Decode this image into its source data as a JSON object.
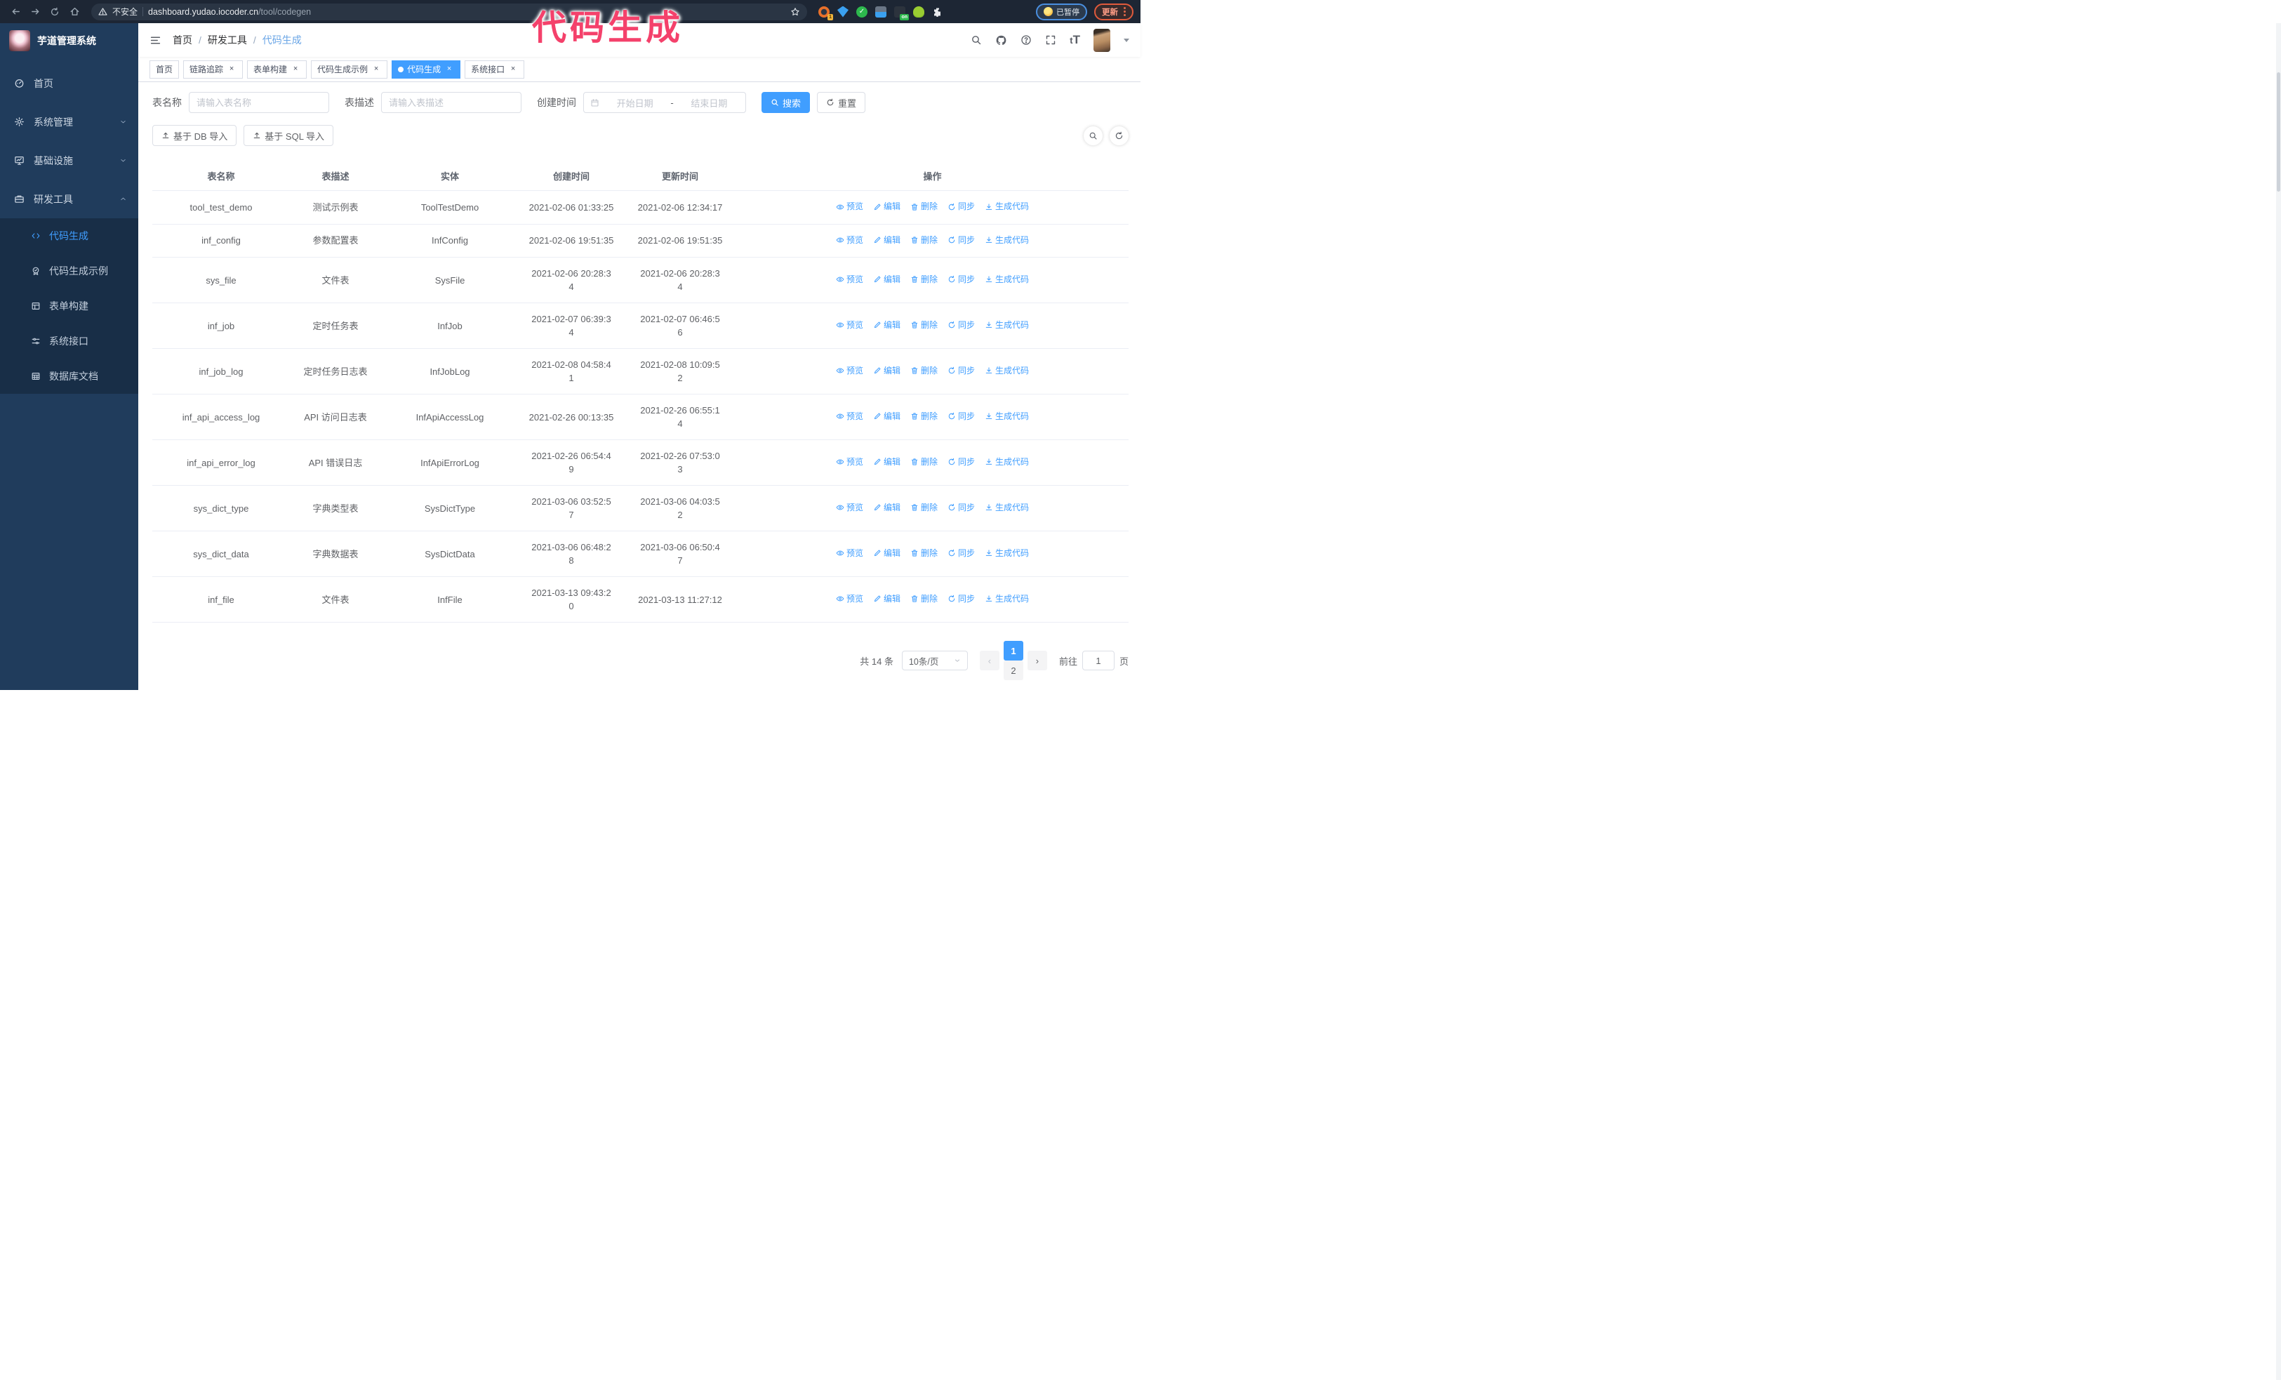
{
  "browser": {
    "security_label": "不安全",
    "url_host": "dashboard.yudao.iocoder.cn",
    "url_path": "/tool/codegen",
    "extension_badge": "1",
    "extension_on_badge": "on",
    "paused_badge": "已暂停",
    "update_button": "更新"
  },
  "annotation": {
    "text": "代码生成",
    "color": "#f4416b"
  },
  "sidebar": {
    "title": "芋道管理系统",
    "items": [
      {
        "label": "首页",
        "icon": "dashboard",
        "chevron": null
      },
      {
        "label": "系统管理",
        "icon": "gear",
        "chevron": "down"
      },
      {
        "label": "基础设施",
        "icon": "monitor",
        "chevron": "down"
      },
      {
        "label": "研发工具",
        "icon": "toolbox",
        "chevron": "up"
      }
    ],
    "submenu": [
      {
        "label": "代码生成",
        "icon": "code",
        "active": true
      },
      {
        "label": "代码生成示例",
        "icon": "example",
        "active": false
      },
      {
        "label": "表单构建",
        "icon": "form",
        "active": false
      },
      {
        "label": "系统接口",
        "icon": "sliders",
        "active": false
      },
      {
        "label": "数据库文档",
        "icon": "dbdoc",
        "active": false
      }
    ]
  },
  "breadcrumb": {
    "items": [
      "首页",
      "研发工具",
      "代码生成"
    ],
    "separator": "/"
  },
  "tabs": [
    {
      "label": "首页",
      "closable": false,
      "active": false
    },
    {
      "label": "链路追踪",
      "closable": true,
      "active": false
    },
    {
      "label": "表单构建",
      "closable": true,
      "active": false
    },
    {
      "label": "代码生成示例",
      "closable": true,
      "active": false
    },
    {
      "label": "代码生成",
      "closable": true,
      "active": true
    },
    {
      "label": "系统接口",
      "closable": true,
      "active": false
    }
  ],
  "search_form": {
    "name_label": "表名称",
    "name_placeholder": "请输入表名称",
    "desc_label": "表描述",
    "desc_placeholder": "请输入表描述",
    "time_label": "创建时间",
    "start_placeholder": "开始日期",
    "range_separator": "-",
    "end_placeholder": "结束日期",
    "search_button": "搜索",
    "reset_button": "重置"
  },
  "toolbar": {
    "db_import": "基于 DB 导入",
    "sql_import": "基于 SQL 导入"
  },
  "table": {
    "columns": [
      "表名称",
      "表描述",
      "实体",
      "创建时间",
      "更新时间",
      "操作"
    ],
    "actions": [
      "预览",
      "编辑",
      "删除",
      "同步",
      "生成代码"
    ],
    "rows": [
      {
        "name": "tool_test_demo",
        "desc": "测试示例表",
        "entity": "ToolTestDemo",
        "create": "2021-02-06 01:33:25",
        "update": "2021-02-06 12:34:17"
      },
      {
        "name": "inf_config",
        "desc": "参数配置表",
        "entity": "InfConfig",
        "create": "2021-02-06 19:51:35",
        "update": "2021-02-06 19:51:35"
      },
      {
        "name": "sys_file",
        "desc": "文件表",
        "entity": "SysFile",
        "create": "2021-02-06 20:28:3\n4",
        "update": "2021-02-06 20:28:3\n4"
      },
      {
        "name": "inf_job",
        "desc": "定时任务表",
        "entity": "InfJob",
        "create": "2021-02-07 06:39:3\n4",
        "update": "2021-02-07 06:46:5\n6"
      },
      {
        "name": "inf_job_log",
        "desc": "定时任务日志表",
        "entity": "InfJobLog",
        "create": "2021-02-08 04:58:4\n1",
        "update": "2021-02-08 10:09:5\n2"
      },
      {
        "name": "inf_api_access_log",
        "desc": "API 访问日志表",
        "entity": "InfApiAccessLog",
        "create": "2021-02-26 00:13:35",
        "update": "2021-02-26 06:55:1\n4"
      },
      {
        "name": "inf_api_error_log",
        "desc": "API 错误日志",
        "entity": "InfApiErrorLog",
        "create": "2021-02-26 06:54:4\n9",
        "update": "2021-02-26 07:53:0\n3"
      },
      {
        "name": "sys_dict_type",
        "desc": "字典类型表",
        "entity": "SysDictType",
        "create": "2021-03-06 03:52:5\n7",
        "update": "2021-03-06 04:03:5\n2"
      },
      {
        "name": "sys_dict_data",
        "desc": "字典数据表",
        "entity": "SysDictData",
        "create": "2021-03-06 06:48:2\n8",
        "update": "2021-03-06 06:50:4\n7"
      },
      {
        "name": "inf_file",
        "desc": "文件表",
        "entity": "InfFile",
        "create": "2021-03-13 09:43:2\n0",
        "update": "2021-03-13 11:27:12"
      }
    ]
  },
  "pagination": {
    "total": "共 14 条",
    "page_size": "10条/页",
    "pages": [
      "1",
      "2"
    ],
    "active_page": "1",
    "jump_prefix": "前往",
    "jump_value": "1",
    "jump_suffix": "页"
  },
  "colors": {
    "accent": "#409eff",
    "sidebar_bg": "#203c5c",
    "submenu_bg": "#182e47",
    "browser_bar": "#1d2634",
    "annotation": "#f4416b"
  }
}
